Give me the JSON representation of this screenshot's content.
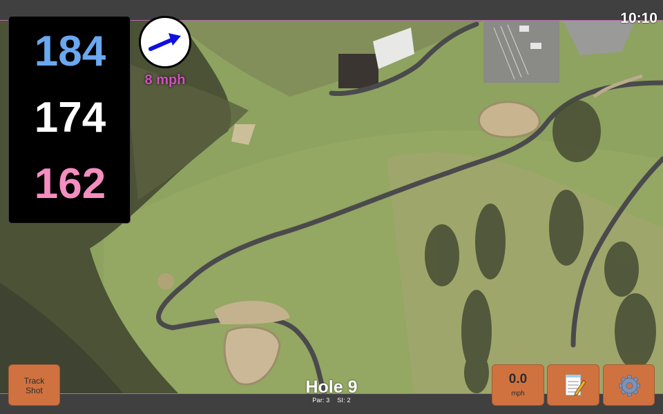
{
  "status": {
    "time": "10:10"
  },
  "distances": {
    "back": "184",
    "middle": "174",
    "front": "162"
  },
  "wind": {
    "speed": "8 mph",
    "icon": "wind-direction-arrow-icon",
    "arrow_color": "#1010e0"
  },
  "hole": {
    "title": "Hole 9",
    "par": "Par: 3",
    "si": "SI: 2"
  },
  "buttons": {
    "track_shot_line1": "Track",
    "track_shot_line2": "Shot",
    "speed_value": "0.0",
    "speed_unit": "mph",
    "notes_icon": "notepad-icon",
    "settings_icon": "gear-icon"
  },
  "colors": {
    "back_distance": "#6aa8ef",
    "middle_distance": "#ffffff",
    "front_distance": "#f48dc0",
    "wind_text": "#d14fbf",
    "button_bg": "#d07240"
  }
}
